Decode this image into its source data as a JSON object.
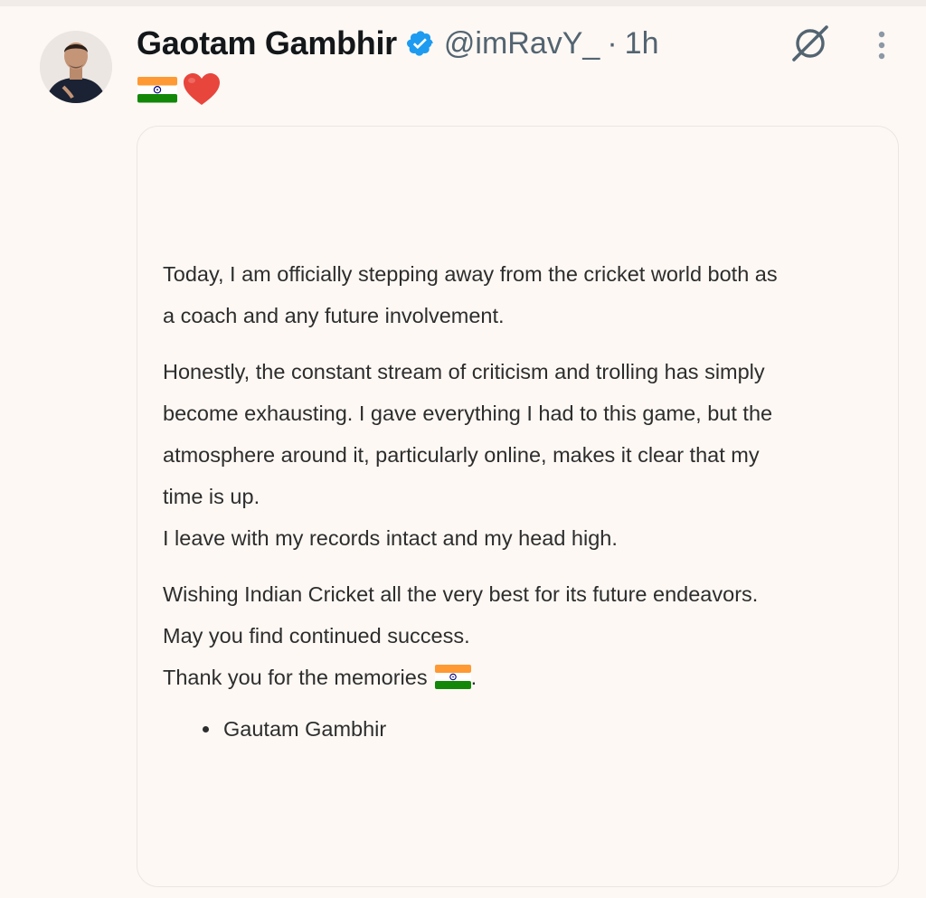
{
  "post": {
    "author_name": "Gaotam Gambhir",
    "handle": "@imRavY_",
    "separator": "·",
    "time": "1h",
    "verified": true,
    "accent_color": "#1d9bf0",
    "text_emojis": [
      "india-flag-emoji",
      "red-heart-emoji"
    ]
  },
  "statement": {
    "paragraphs": [
      {
        "lines": [
          "Today, I am officially stepping away from the cricket world both as",
          "a coach and any future involvement."
        ]
      },
      {
        "lines": [
          "Honestly, the constant stream of criticism and trolling has simply",
          "become exhausting. I gave everything I had to this game, but the",
          "atmosphere around it, particularly online, makes it clear that my",
          "time is up.",
          "I leave with my records intact and my head high."
        ]
      },
      {
        "lines": [
          "Wishing Indian Cricket all the very best for its future endeavors.",
          "May you find continued success.",
          "Thank you for the memories"
        ],
        "last_line_suffix": "."
      }
    ],
    "signature": "Gautam Gambhir"
  },
  "icons": {
    "verified": "verified-badge-icon",
    "grok": "grok-icon",
    "more": "more-vertical-icon"
  }
}
